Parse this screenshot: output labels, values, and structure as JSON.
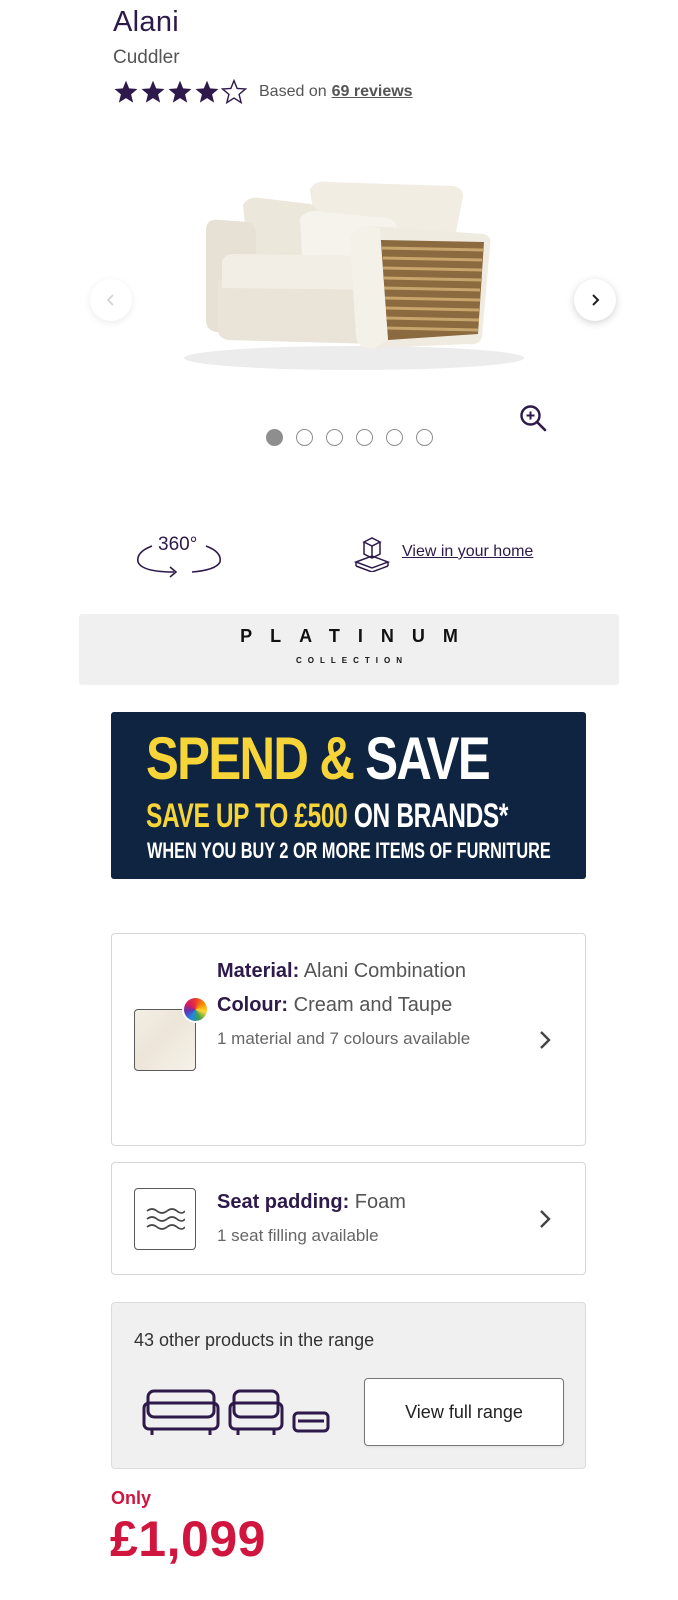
{
  "product": {
    "name": "Alani",
    "type": "Cuddler",
    "rating": 4,
    "rating_max": 5,
    "based_on_text": "Based on",
    "reviews_text": "69 reviews"
  },
  "gallery": {
    "image_count": 6,
    "active_index": 0,
    "prev_icon": "chevron-left-icon",
    "next_icon": "chevron-right-icon",
    "zoom_icon": "zoom-in-icon"
  },
  "features": {
    "three_sixty": "360°",
    "view_in_home": "View in your home"
  },
  "collection": {
    "name": "PLATINUM",
    "sub": "COLLECTION"
  },
  "promo": {
    "headline_spend": "SPEND &",
    "headline_save": "SAVE",
    "line2_a": "SAVE UP TO ",
    "line2_b": "£500",
    "line2_c": " ON BRANDS*",
    "line3": "WHEN YOU BUY 2 OR MORE ITEMS OF FURNITURE",
    "colors": {
      "background": "#0e2440",
      "accent": "#f7d437"
    }
  },
  "material_card": {
    "material_label": "Material:",
    "material_value": "Alani Combination",
    "colour_label": "Colour:",
    "colour_value": "Cream and Taupe",
    "availability": "1 material and 7 colours available"
  },
  "seat_card": {
    "label": "Seat padding:",
    "value": "Foam",
    "availability": "1 seat filling available"
  },
  "range": {
    "text": "43 other products in the range",
    "button": "View full range"
  },
  "price": {
    "prefix": "Only",
    "value": "£1,099",
    "color": "#d0153f"
  },
  "theme": {
    "primary": "#2d1a4a",
    "star_color": "#2d1a4a"
  }
}
